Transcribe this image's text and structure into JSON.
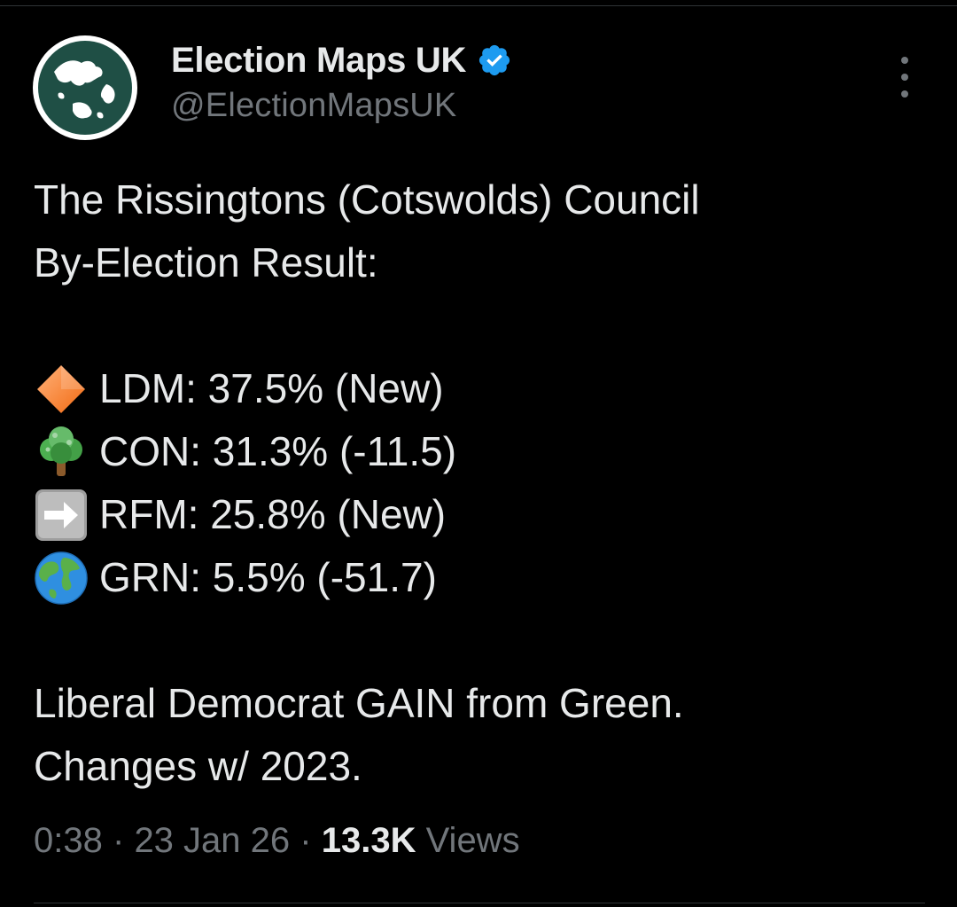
{
  "tweet": {
    "author": {
      "display_name": "Election Maps UK",
      "handle": "@ElectionMapsUK",
      "verified": true,
      "avatar_icon": "globe-logo-icon"
    },
    "menu_icon": "more-vertical-icon",
    "text": {
      "title_line_1": "The Rissingtons (Cotswolds) Council",
      "title_line_2": "By-Election Result:",
      "results": [
        {
          "icon": "orange-diamond-icon",
          "text": "LDM: 37.5% (New)"
        },
        {
          "icon": "tree-icon",
          "text": "CON: 31.3% (-11.5)"
        },
        {
          "icon": "right-arrow-icon",
          "text": "RFM: 25.8% (New)"
        },
        {
          "icon": "globe-icon",
          "text": "GRN: 5.5% (-51.7)"
        }
      ],
      "footer_line_1": "Liberal Democrat GAIN from Green.",
      "footer_line_2": "Changes w/ 2023."
    },
    "meta": {
      "time": "0:38",
      "separator": "·",
      "date": "23 Jan 26",
      "views_count": "13.3K",
      "views_label": "Views"
    }
  },
  "colors": {
    "background": "#000000",
    "primary_text": "#e7e9ea",
    "secondary_text": "#71767b",
    "verified_blue": "#1d9bf0",
    "avatar_green": "#1f4f45",
    "divider": "#2f3336"
  }
}
